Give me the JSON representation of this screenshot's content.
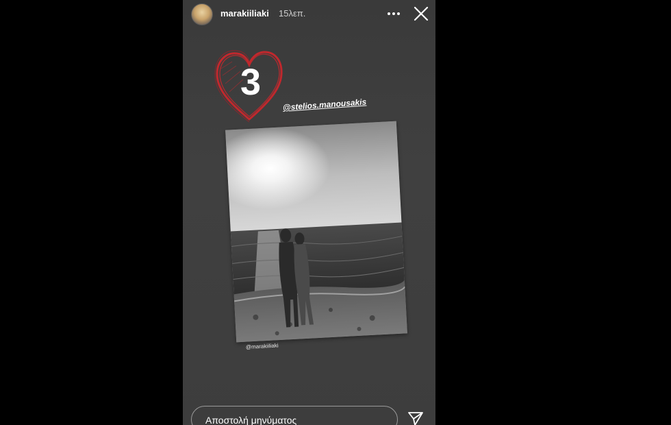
{
  "header": {
    "username": "marakiiliaki",
    "time": "15λεπ."
  },
  "story": {
    "sticker_number": "3",
    "mention": "@stelios.manousakis",
    "photo_caption": "@marakiiliaki",
    "heart_color": "#c0282d"
  },
  "footer": {
    "message_placeholder": "Αποστολή μηνύματος"
  },
  "icons": {
    "more": "more-options-icon",
    "close": "close-icon",
    "send": "send-icon"
  }
}
